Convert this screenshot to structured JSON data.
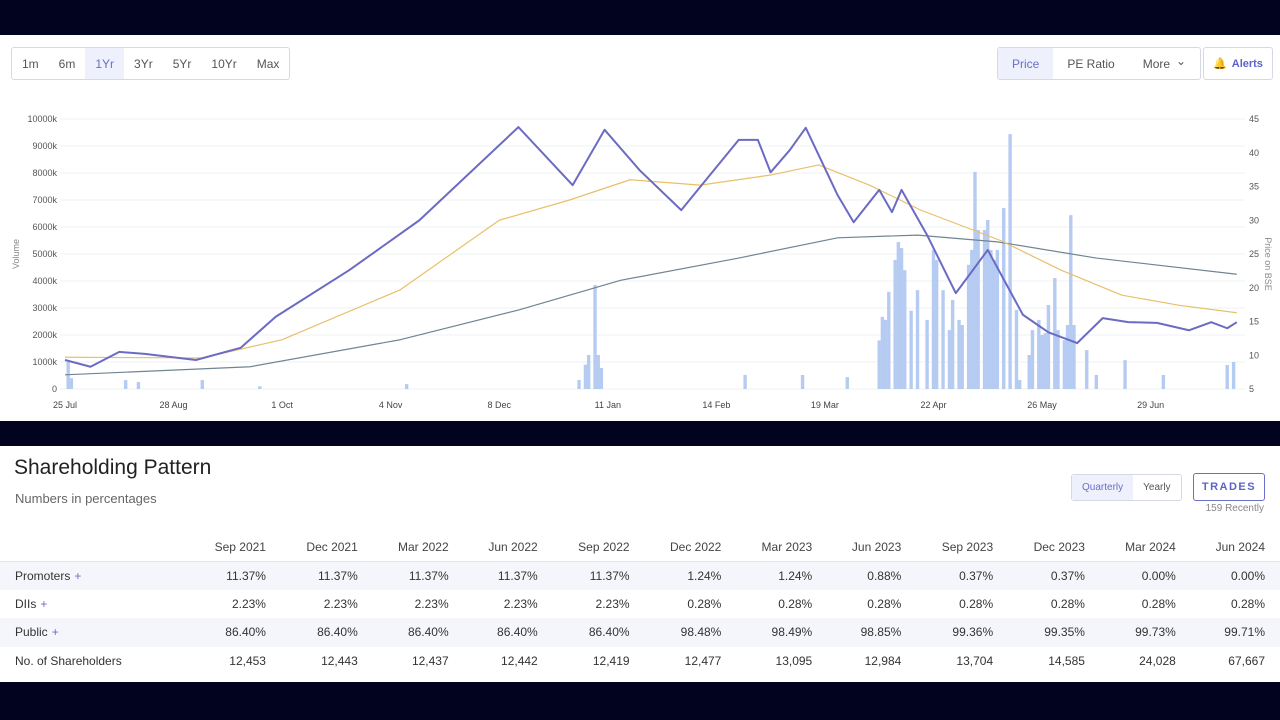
{
  "toolbar": {
    "ranges": [
      "1m",
      "6m",
      "1Yr",
      "3Yr",
      "5Yr",
      "10Yr",
      "Max"
    ],
    "active_range": "1Yr",
    "views": [
      "Price",
      "PE Ratio",
      "More"
    ],
    "active_view": "Price",
    "alerts": "Alerts"
  },
  "colors": {
    "price": "#6b6bc4",
    "dma50": "#e8c06a",
    "dma200": "#6f8591",
    "volume": "#b6cbf2",
    "accent": "#6a6fc9"
  },
  "chart_data": {
    "type": "line",
    "ylabel_left": "Volume",
    "ylabel_right": "Price on BSE",
    "ylim_left": [
      0,
      10000
    ],
    "ylim_right": [
      5,
      45
    ],
    "yticks_left": [
      "0",
      "1000k",
      "2000k",
      "3000k",
      "4000k",
      "5000k",
      "6000k",
      "7000k",
      "8000k",
      "9000k",
      "10000k"
    ],
    "yticks_right": [
      "5",
      "10",
      "15",
      "20",
      "25",
      "30",
      "35",
      "40",
      "45"
    ],
    "xticks": [
      [
        "2023-07-25",
        "25 Jul"
      ],
      [
        "2023-08-28",
        "28 Aug"
      ],
      [
        "2023-10-01",
        "1 Oct"
      ],
      [
        "2023-11-04",
        "4 Nov"
      ],
      [
        "2023-12-08",
        "8 Dec"
      ],
      [
        "2024-01-11",
        "11 Jan"
      ],
      [
        "2024-02-14",
        "14 Feb"
      ],
      [
        "2024-03-19",
        "19 Mar"
      ],
      [
        "2024-04-22",
        "22 Apr"
      ],
      [
        "2024-05-26",
        "26 May"
      ],
      [
        "2024-06-29",
        "29 Jun"
      ]
    ],
    "xlim": [
      "2023-07-25",
      "2024-07-27"
    ],
    "grid": true,
    "price": [
      [
        "2023-07-25",
        9.3
      ],
      [
        "2023-08-02",
        8.3
      ],
      [
        "2023-08-11",
        10.5
      ],
      [
        "2023-08-19",
        10.2
      ],
      [
        "2023-09-04",
        9.3
      ],
      [
        "2023-09-18",
        11.1
      ],
      [
        "2023-09-29",
        15.7
      ],
      [
        "2023-10-22",
        22.6
      ],
      [
        "2023-11-13",
        30
      ],
      [
        "2023-12-14",
        43.8
      ],
      [
        "2023-12-31",
        35.2
      ],
      [
        "2024-01-10",
        43.4
      ],
      [
        "2024-01-21",
        37.4
      ],
      [
        "2024-02-03",
        31.5
      ],
      [
        "2024-02-21",
        41.9
      ],
      [
        "2024-02-27",
        41.9
      ],
      [
        "2024-03-02",
        37.1
      ],
      [
        "2024-03-08",
        40.4
      ],
      [
        "2024-03-13",
        43.7
      ],
      [
        "2024-03-23",
        33.7
      ],
      [
        "2024-03-28",
        29.7
      ],
      [
        "2024-04-05",
        34.5
      ],
      [
        "2024-04-09",
        31.2
      ],
      [
        "2024-04-12",
        34.5
      ],
      [
        "2024-04-20",
        27.8
      ],
      [
        "2024-04-29",
        19.2
      ],
      [
        "2024-05-09",
        25.6
      ],
      [
        "2024-05-20",
        16
      ],
      [
        "2024-05-28",
        13.4
      ],
      [
        "2024-06-06",
        11.8
      ],
      [
        "2024-06-14",
        15.5
      ],
      [
        "2024-06-22",
        14.9
      ],
      [
        "2024-07-01",
        14.8
      ],
      [
        "2024-07-11",
        13.7
      ],
      [
        "2024-07-18",
        14.9
      ],
      [
        "2024-07-23",
        14
      ],
      [
        "2024-07-26",
        14.9
      ]
    ],
    "dma50": [
      [
        "2023-07-25",
        9.7
      ],
      [
        "2023-09-06",
        9.6
      ],
      [
        "2023-10-01",
        12.3
      ],
      [
        "2023-11-07",
        19.7
      ],
      [
        "2023-12-08",
        30
      ],
      [
        "2023-12-30",
        33
      ],
      [
        "2024-01-18",
        36
      ],
      [
        "2024-02-09",
        35.2
      ],
      [
        "2024-03-02",
        36.7
      ],
      [
        "2024-03-17",
        38.2
      ],
      [
        "2024-04-02",
        35.2
      ],
      [
        "2024-04-18",
        31.5
      ],
      [
        "2024-05-13",
        27
      ],
      [
        "2024-06-01",
        22.6
      ],
      [
        "2024-06-20",
        18.9
      ],
      [
        "2024-07-08",
        17.4
      ],
      [
        "2024-07-26",
        16.3
      ]
    ],
    "dma200": [
      [
        "2023-07-25",
        7.1
      ],
      [
        "2023-09-21",
        8.3
      ],
      [
        "2023-11-07",
        12.3
      ],
      [
        "2023-12-14",
        16.7
      ],
      [
        "2024-01-15",
        21.1
      ],
      [
        "2024-02-21",
        24.4
      ],
      [
        "2024-03-23",
        27.4
      ],
      [
        "2024-04-17",
        27.8
      ],
      [
        "2024-05-12",
        26.8
      ],
      [
        "2024-06-12",
        24.4
      ],
      [
        "2024-07-26",
        22
      ]
    ],
    "volume": [
      [
        "2023-07-26",
        1000
      ],
      [
        "2023-07-27",
        400
      ],
      [
        "2023-08-13",
        330
      ],
      [
        "2023-08-17",
        260
      ],
      [
        "2023-09-06",
        330
      ],
      [
        "2023-09-24",
        100
      ],
      [
        "2023-11-09",
        180
      ],
      [
        "2024-01-02",
        330
      ],
      [
        "2024-01-04",
        900
      ],
      [
        "2024-01-05",
        1260
      ],
      [
        "2024-01-07",
        3850
      ],
      [
        "2024-01-08",
        1260
      ],
      [
        "2024-01-09",
        780
      ],
      [
        "2024-02-23",
        520
      ],
      [
        "2024-03-12",
        520
      ],
      [
        "2024-03-26",
        440
      ],
      [
        "2024-04-05",
        1800
      ],
      [
        "2024-04-06",
        2670
      ],
      [
        "2024-04-07",
        2560
      ],
      [
        "2024-04-08",
        3600
      ],
      [
        "2024-04-10",
        4780
      ],
      [
        "2024-04-11",
        5440
      ],
      [
        "2024-04-12",
        5220
      ],
      [
        "2024-04-13",
        4400
      ],
      [
        "2024-04-15",
        2900
      ],
      [
        "2024-04-17",
        3660
      ],
      [
        "2024-04-20",
        2560
      ],
      [
        "2024-04-22",
        5150
      ],
      [
        "2024-04-23",
        4780
      ],
      [
        "2024-04-25",
        3660
      ],
      [
        "2024-04-27",
        2180
      ],
      [
        "2024-04-28",
        3300
      ],
      [
        "2024-04-30",
        2560
      ],
      [
        "2024-05-01",
        2370
      ],
      [
        "2024-05-03",
        4600
      ],
      [
        "2024-05-04",
        5150
      ],
      [
        "2024-05-05",
        8040
      ],
      [
        "2024-05-06",
        5890
      ],
      [
        "2024-05-08",
        5890
      ],
      [
        "2024-05-09",
        6260
      ],
      [
        "2024-05-10",
        5150
      ],
      [
        "2024-05-11",
        4780
      ],
      [
        "2024-05-12",
        5150
      ],
      [
        "2024-05-14",
        6700
      ],
      [
        "2024-05-16",
        9440
      ],
      [
        "2024-05-18",
        2930
      ],
      [
        "2024-05-19",
        330
      ],
      [
        "2024-05-22",
        1260
      ],
      [
        "2024-05-23",
        2180
      ],
      [
        "2024-05-25",
        2560
      ],
      [
        "2024-05-26",
        2000
      ],
      [
        "2024-05-27",
        2070
      ],
      [
        "2024-05-28",
        3110
      ],
      [
        "2024-05-30",
        4110
      ],
      [
        "2024-05-31",
        2180
      ],
      [
        "2024-06-02",
        1810
      ],
      [
        "2024-06-03",
        2370
      ],
      [
        "2024-06-04",
        6440
      ],
      [
        "2024-06-05",
        2370
      ],
      [
        "2024-06-09",
        1440
      ],
      [
        "2024-06-12",
        520
      ],
      [
        "2024-06-21",
        1070
      ],
      [
        "2024-07-03",
        520
      ],
      [
        "2024-07-23",
        890
      ],
      [
        "2024-07-25",
        1000
      ]
    ]
  },
  "shareholding": {
    "title": "Shareholding Pattern",
    "subtitle": "Numbers in percentages",
    "toggle": [
      "Quarterly",
      "Yearly"
    ],
    "active": "Quarterly",
    "trades": "TRADES",
    "trades_note": "159 Recently",
    "columns": [
      "Sep 2021",
      "Dec 2021",
      "Mar 2022",
      "Jun 2022",
      "Sep 2022",
      "Dec 2022",
      "Mar 2023",
      "Jun 2023",
      "Sep 2023",
      "Dec 2023",
      "Mar 2024",
      "Jun 2024"
    ],
    "rows": [
      {
        "label": "Promoters",
        "expand": "+",
        "values": [
          "11.37%",
          "11.37%",
          "11.37%",
          "11.37%",
          "11.37%",
          "1.24%",
          "1.24%",
          "0.88%",
          "0.37%",
          "0.37%",
          "0.00%",
          "0.00%"
        ]
      },
      {
        "label": "DIIs",
        "expand": "+",
        "values": [
          "2.23%",
          "2.23%",
          "2.23%",
          "2.23%",
          "2.23%",
          "0.28%",
          "0.28%",
          "0.28%",
          "0.28%",
          "0.28%",
          "0.28%",
          "0.28%"
        ]
      },
      {
        "label": "Public",
        "expand": "+",
        "values": [
          "86.40%",
          "86.40%",
          "86.40%",
          "86.40%",
          "86.40%",
          "98.48%",
          "98.49%",
          "98.85%",
          "99.36%",
          "99.35%",
          "99.73%",
          "99.71%"
        ]
      },
      {
        "label": "No. of Shareholders",
        "expand": "",
        "values": [
          "12,453",
          "12,443",
          "12,437",
          "12,442",
          "12,419",
          "12,477",
          "13,095",
          "12,984",
          "13,704",
          "14,585",
          "24,028",
          "67,667"
        ]
      }
    ]
  }
}
